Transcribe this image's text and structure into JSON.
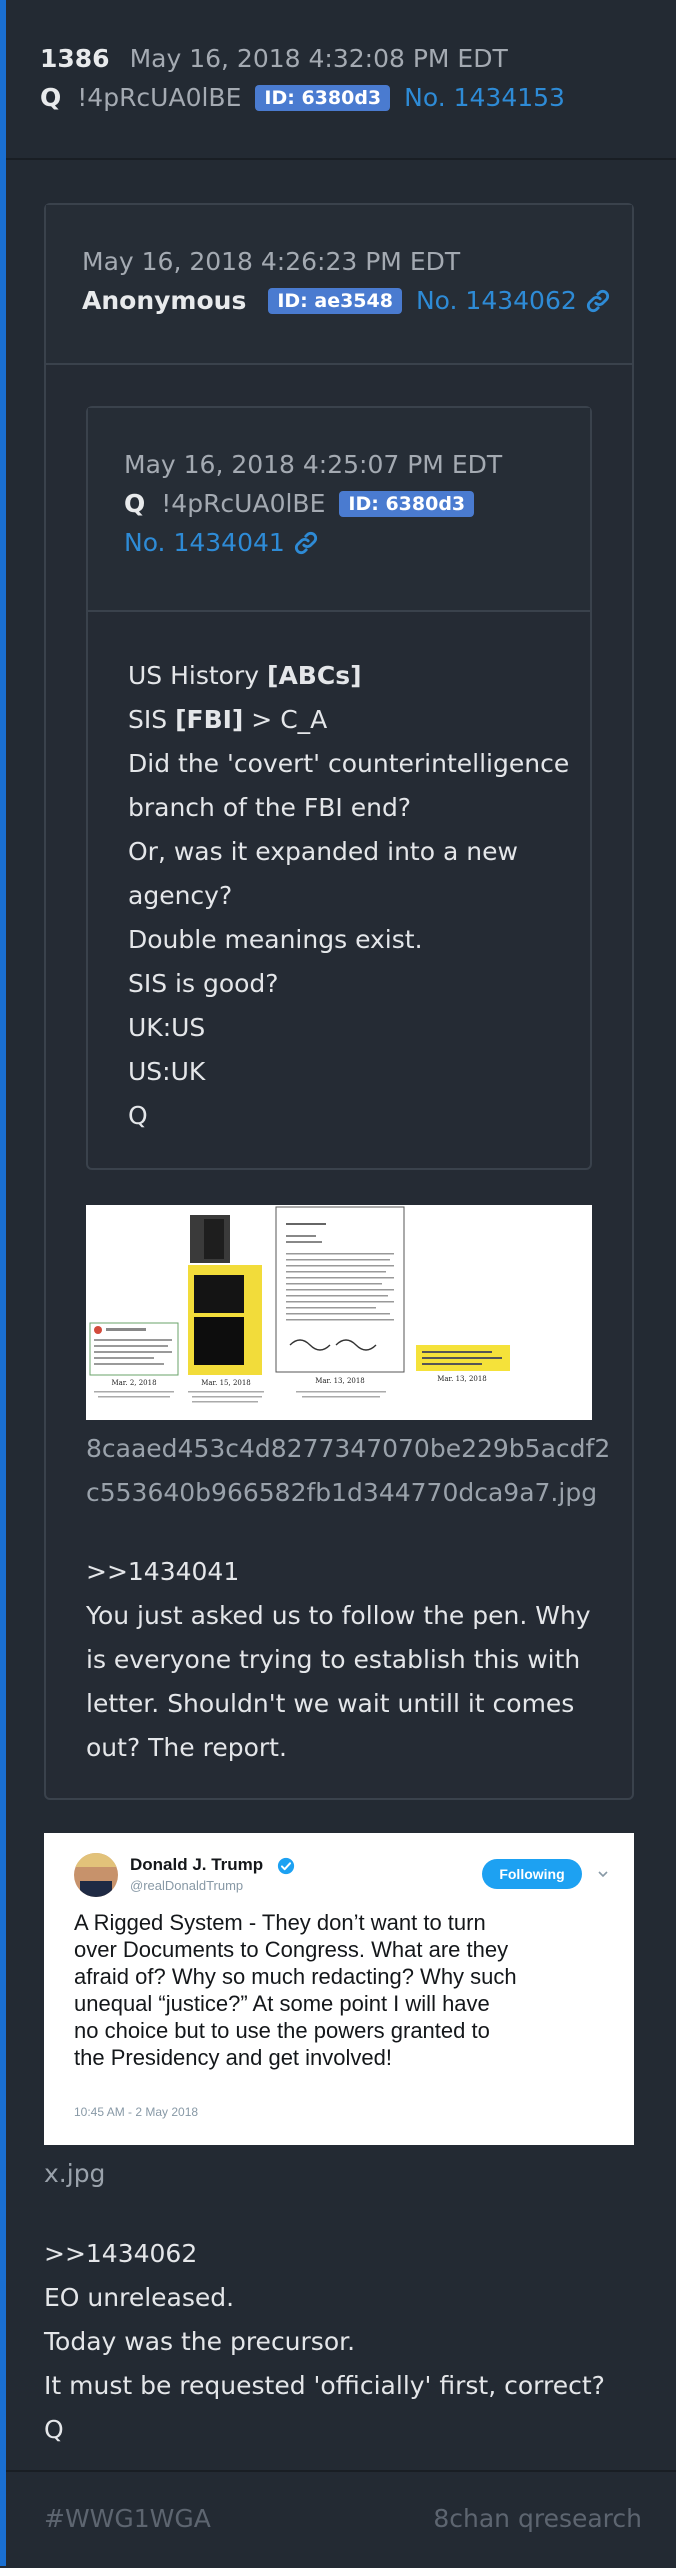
{
  "post": {
    "number": "1386",
    "date": "May 16, 2018 4:32:08 PM EDT",
    "author": "Q",
    "tripcode": "!4pRcUA0lBE",
    "id_label": "ID: 6380d3",
    "post_ref": "No. 1434153"
  },
  "quoted_post": {
    "date": "May 16, 2018 4:26:23 PM EDT",
    "author": "Anonymous",
    "id_label": "ID: ae3548",
    "post_ref": "No. 1434062",
    "inner_post": {
      "date": "May 16, 2018 4:25:07 PM EDT",
      "author": "Q",
      "tripcode": "!4pRcUA0lBE",
      "id_label": "ID: 6380d3",
      "post_ref": "No. 1434041",
      "line1_text": "US History ",
      "line1_bold": "[ABCs]",
      "line2_text_a": "SIS ",
      "line2_bold": "[FBI]",
      "line2_text_b": " > C_A",
      "line3": "Did the 'covert' counterintelligence",
      "line4": "branch of the FBI end?",
      "line5": "Or, was it expanded into a new",
      "line6": "agency?",
      "line7": "Double meanings exist.",
      "line8": "SIS is good?",
      "line9": "UK:US",
      "line10": "US:UK",
      "line11": "Q"
    },
    "image": {
      "filename_line1": "8caaed453c4d8277347070be229b5acdf2",
      "filename_line2": "c553640b966582fb1d344770dca9a7.jpg",
      "captions": [
        "Mar. 2, 2018",
        "Mar. 15, 2018",
        "Mar. 13, 2018",
        "Mar. 13, 2018"
      ]
    },
    "reply_ref": ">>1434041",
    "reply_lines": [
      "You just asked us to follow the pen. Why",
      "is everyone trying to establish this with",
      "letter. Shouldn't we wait untill it comes",
      "out? The report."
    ]
  },
  "tweet_image": {
    "display_name": "Donald J. Trump",
    "handle": "@realDonaldTrump",
    "follow_label": "Following",
    "text_lines": [
      "A Rigged System - They don’t want to turn",
      "over Documents to Congress. What are they",
      "afraid of? Why so much redacting? Why such",
      "unequal “justice?” At some point I will have",
      "no choice but to use the powers granted to",
      "the Presidency and get involved!"
    ],
    "timestamp": "10:45 AM - 2 May 2018",
    "filename": "x.jpg"
  },
  "reply": {
    "ref": ">>1434062",
    "lines": [
      "EO unreleased.",
      "Today was the precursor.",
      "It must be requested 'officially' first, correct?",
      "Q"
    ]
  },
  "footer": {
    "tag": "#WWG1WGA",
    "site": "8chan qresearch"
  },
  "colors": {
    "link": "#2e8bd6",
    "id_badge": "#4a7bd0",
    "left_bar": "#1a6fd1",
    "twitter_blue": "#1da1f2"
  }
}
